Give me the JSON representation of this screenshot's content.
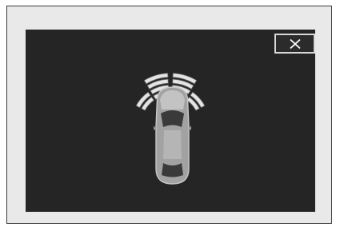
{
  "dialog": {
    "close_button": {
      "icon": "close-icon",
      "color": "#ffffff"
    }
  },
  "display": {
    "background": "#252525",
    "frame_background": "#e9e9e9",
    "vehicle": {
      "icon": "car-top-view-icon",
      "color": "#9a9a9a"
    },
    "sensor_zones": [
      {
        "name": "front-left-corner",
        "segments_active": 2,
        "icon": "sensor-arc-icon"
      },
      {
        "name": "front-left-center",
        "segments_active": 4,
        "icon": "sensor-arc-icon"
      },
      {
        "name": "front-right-center",
        "segments_active": 4,
        "icon": "sensor-arc-icon"
      },
      {
        "name": "front-right-corner",
        "segments_active": 2,
        "icon": "sensor-arc-icon"
      }
    ]
  }
}
